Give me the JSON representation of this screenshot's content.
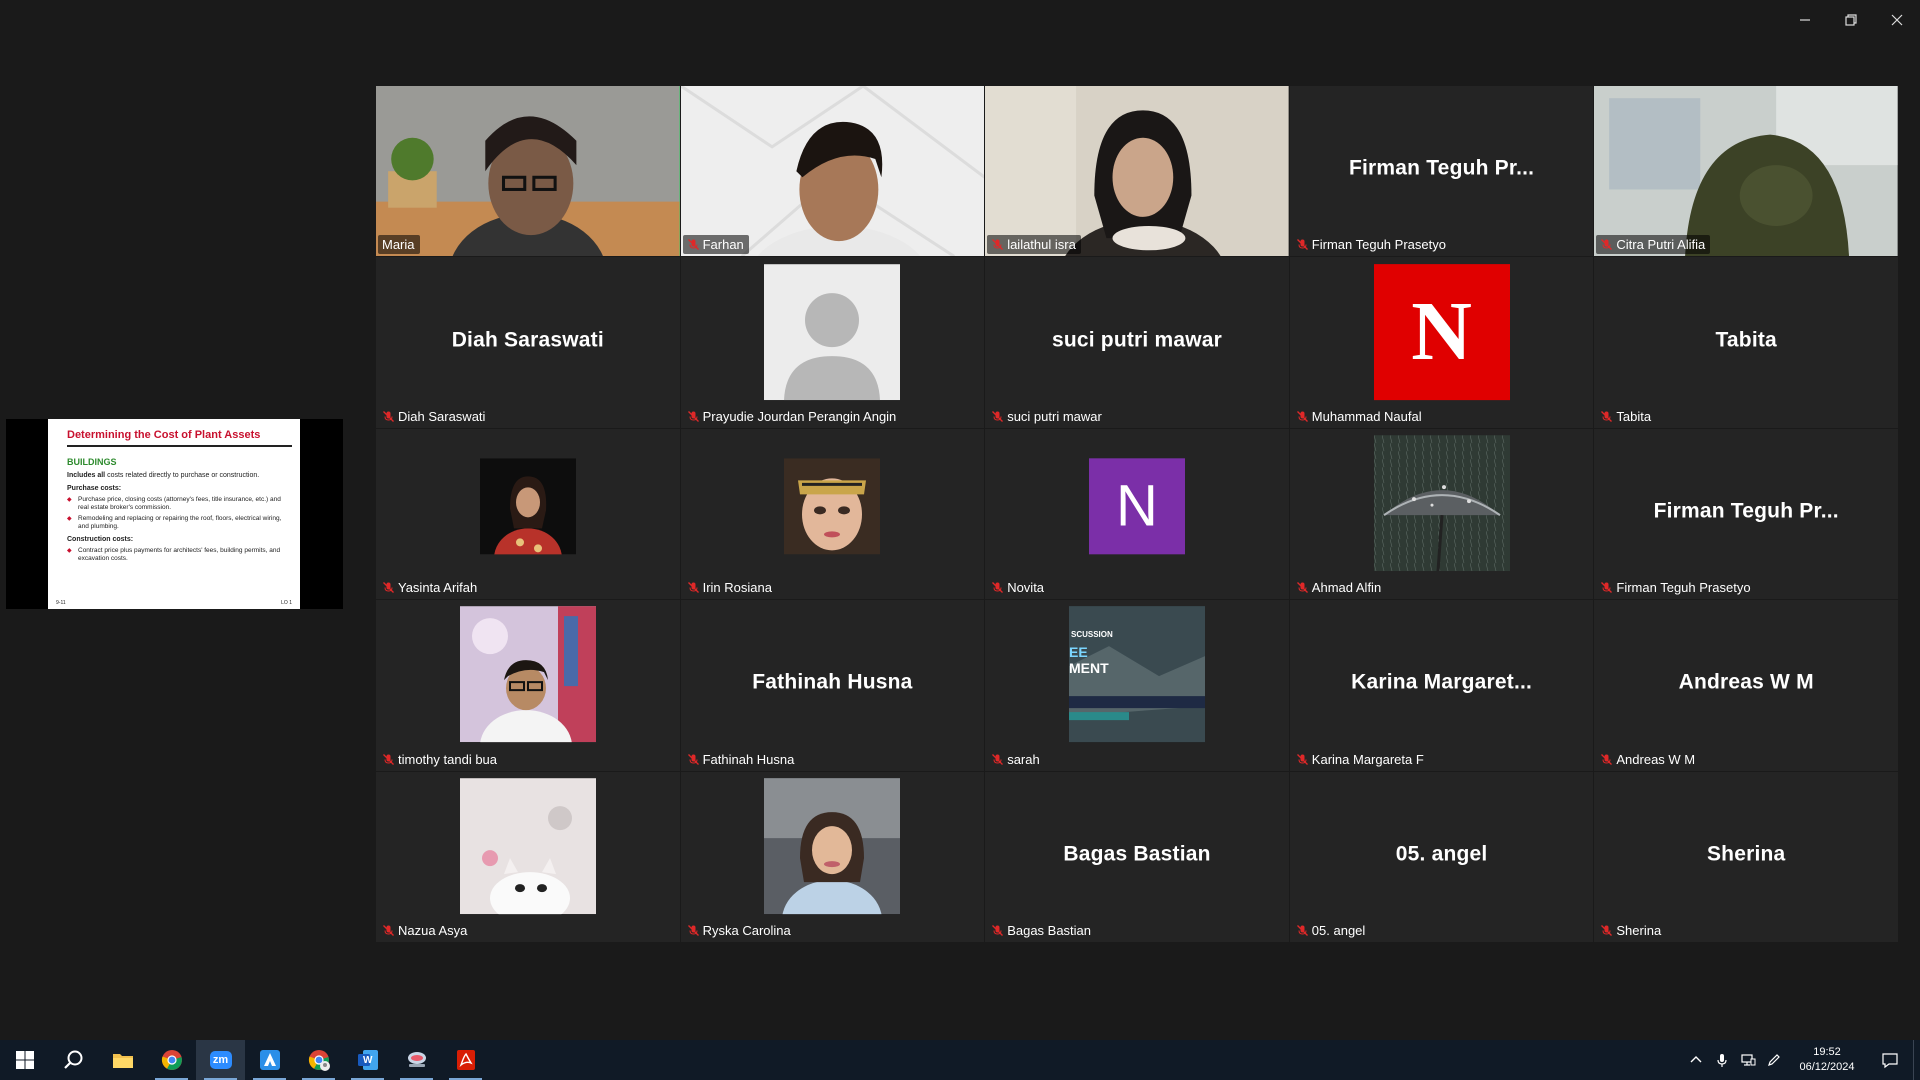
{
  "window": {
    "controls": [
      "minimize-icon",
      "restore-icon",
      "close-icon"
    ]
  },
  "shared_screen": {
    "title": "Determining the Cost of Plant Assets",
    "heading": "BUILDINGS",
    "line1_bold": "Includes all",
    "line1_rest": " costs related directly to purchase or construction.",
    "purchase_label": "Purchase costs:",
    "purchase_bullets": [
      "Purchase price, closing costs (attorney's fees, title insurance, etc.) and real estate broker's commission.",
      "Remodeling and replacing or repairing the roof, floors, electrical wiring, and plumbing."
    ],
    "construction_label": "Construction costs:",
    "construction_bullets": [
      "Contract price plus payments for architects' fees, building permits, and excavation costs."
    ],
    "footer_left": "9-11",
    "footer_right": "LO 1"
  },
  "participants": [
    {
      "name": "Maria",
      "big": "",
      "kind": "video",
      "active": true,
      "muted": false
    },
    {
      "name": "Farhan",
      "big": "",
      "kind": "video",
      "muted": true
    },
    {
      "name": "lailathul isra",
      "big": "",
      "kind": "video",
      "muted": true
    },
    {
      "name": "Firman Teguh Prasetyo",
      "big": "Firman Teguh Pr...",
      "kind": "name",
      "muted": true
    },
    {
      "name": "Citra Putri Alifia",
      "big": "",
      "kind": "video",
      "muted": true
    },
    {
      "name": "Diah Saraswati",
      "big": "Diah Saraswati",
      "kind": "name",
      "muted": true
    },
    {
      "name": "Prayudie Jourdan Perangin Angin",
      "big": "",
      "kind": "avatar-default",
      "muted": true
    },
    {
      "name": "suci putri mawar",
      "big": "suci putri mawar",
      "kind": "name",
      "muted": true
    },
    {
      "name": "Muhammad Naufal",
      "big": "N",
      "kind": "avatar-letter",
      "color": "#e00000",
      "muted": true
    },
    {
      "name": "Tabita",
      "big": "Tabita",
      "kind": "name",
      "muted": true
    },
    {
      "name": "Yasinta Arifah",
      "big": "",
      "kind": "avatar-photo",
      "muted": true
    },
    {
      "name": "Irin Rosiana",
      "big": "",
      "kind": "avatar-photo",
      "muted": true
    },
    {
      "name": "Novita",
      "big": "N",
      "kind": "avatar-letter",
      "color": "#7b2fa8",
      "muted": true
    },
    {
      "name": "Ahmad Alfin",
      "big": "",
      "kind": "avatar-photo",
      "muted": true
    },
    {
      "name": "Firman Teguh Prasetyo",
      "big": "Firman Teguh Pr...",
      "kind": "name",
      "muted": true
    },
    {
      "name": "timothy tandi bua",
      "big": "",
      "kind": "avatar-photo",
      "muted": true
    },
    {
      "name": "Fathinah Husna",
      "big": "Fathinah Husna",
      "kind": "name",
      "muted": true
    },
    {
      "name": "sarah",
      "big": "",
      "kind": "avatar-photo",
      "banner_text_1": "SCUSSION",
      "banner_text_2": "EE",
      "banner_text_3": "MENT",
      "muted": true
    },
    {
      "name": "Karina Margareta F",
      "big": "Karina  Margaret...",
      "kind": "name",
      "muted": true
    },
    {
      "name": "Andreas W M",
      "big": "Andreas W M",
      "kind": "name",
      "muted": true
    },
    {
      "name": "Nazua Asya",
      "big": "",
      "kind": "avatar-photo",
      "muted": true
    },
    {
      "name": "Ryska Carolina",
      "big": "",
      "kind": "avatar-photo",
      "muted": true
    },
    {
      "name": "Bagas Bastian",
      "big": "Bagas Bastian",
      "kind": "name",
      "muted": true
    },
    {
      "name": "05. angel",
      "big": "05. angel",
      "kind": "name",
      "muted": true
    },
    {
      "name": "Sherina",
      "big": "Sherina",
      "kind": "name",
      "muted": true
    }
  ],
  "taskbar": {
    "apps": [
      "windows-start-icon",
      "search-icon",
      "file-explorer-icon",
      "chrome-icon",
      "zoom-icon",
      "azure-data-studio-icon",
      "chrome-profile-icon",
      "word-icon",
      "photos-icon",
      "acrobat-icon"
    ],
    "zoom_label": "zm",
    "word_label": "W",
    "time": "19:52",
    "date": "06/12/2024"
  }
}
